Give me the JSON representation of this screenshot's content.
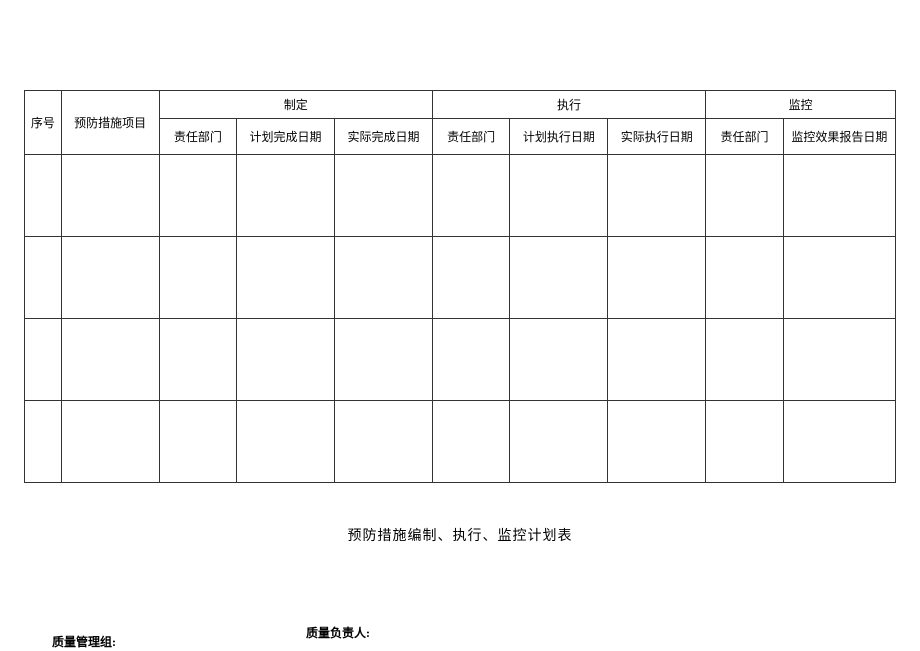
{
  "table": {
    "headers": {
      "seq": "序号",
      "project": "预防措施项目",
      "group_establish": "制定",
      "group_execute": "执行",
      "group_monitor": "监控",
      "dept": "责任部门",
      "plan_complete_date": "计划完成日期",
      "actual_complete_date": "实际完成日期",
      "dept2": "责任部门",
      "plan_execute_date": "计划执行日期",
      "actual_execute_date": "实际执行日期",
      "dept3": "责任部门",
      "monitor_report_date": "监控效果报告日期"
    },
    "rows": [
      {
        "seq": "",
        "project": "",
        "est_dept": "",
        "plan_complete": "",
        "actual_complete": "",
        "exec_dept": "",
        "plan_execute": "",
        "actual_execute": "",
        "mon_dept": "",
        "mon_date": ""
      },
      {
        "seq": "",
        "project": "",
        "est_dept": "",
        "plan_complete": "",
        "actual_complete": "",
        "exec_dept": "",
        "plan_execute": "",
        "actual_execute": "",
        "mon_dept": "",
        "mon_date": ""
      },
      {
        "seq": "",
        "project": "",
        "est_dept": "",
        "plan_complete": "",
        "actual_complete": "",
        "exec_dept": "",
        "plan_execute": "",
        "actual_execute": "",
        "mon_dept": "",
        "mon_date": ""
      },
      {
        "seq": "",
        "project": "",
        "est_dept": "",
        "plan_complete": "",
        "actual_complete": "",
        "exec_dept": "",
        "plan_execute": "",
        "actual_execute": "",
        "mon_dept": "",
        "mon_date": ""
      }
    ]
  },
  "title": "预防措施编制、执行、监控计划表",
  "footer": {
    "left": "质量管理组:",
    "right": "质量负责人:"
  }
}
